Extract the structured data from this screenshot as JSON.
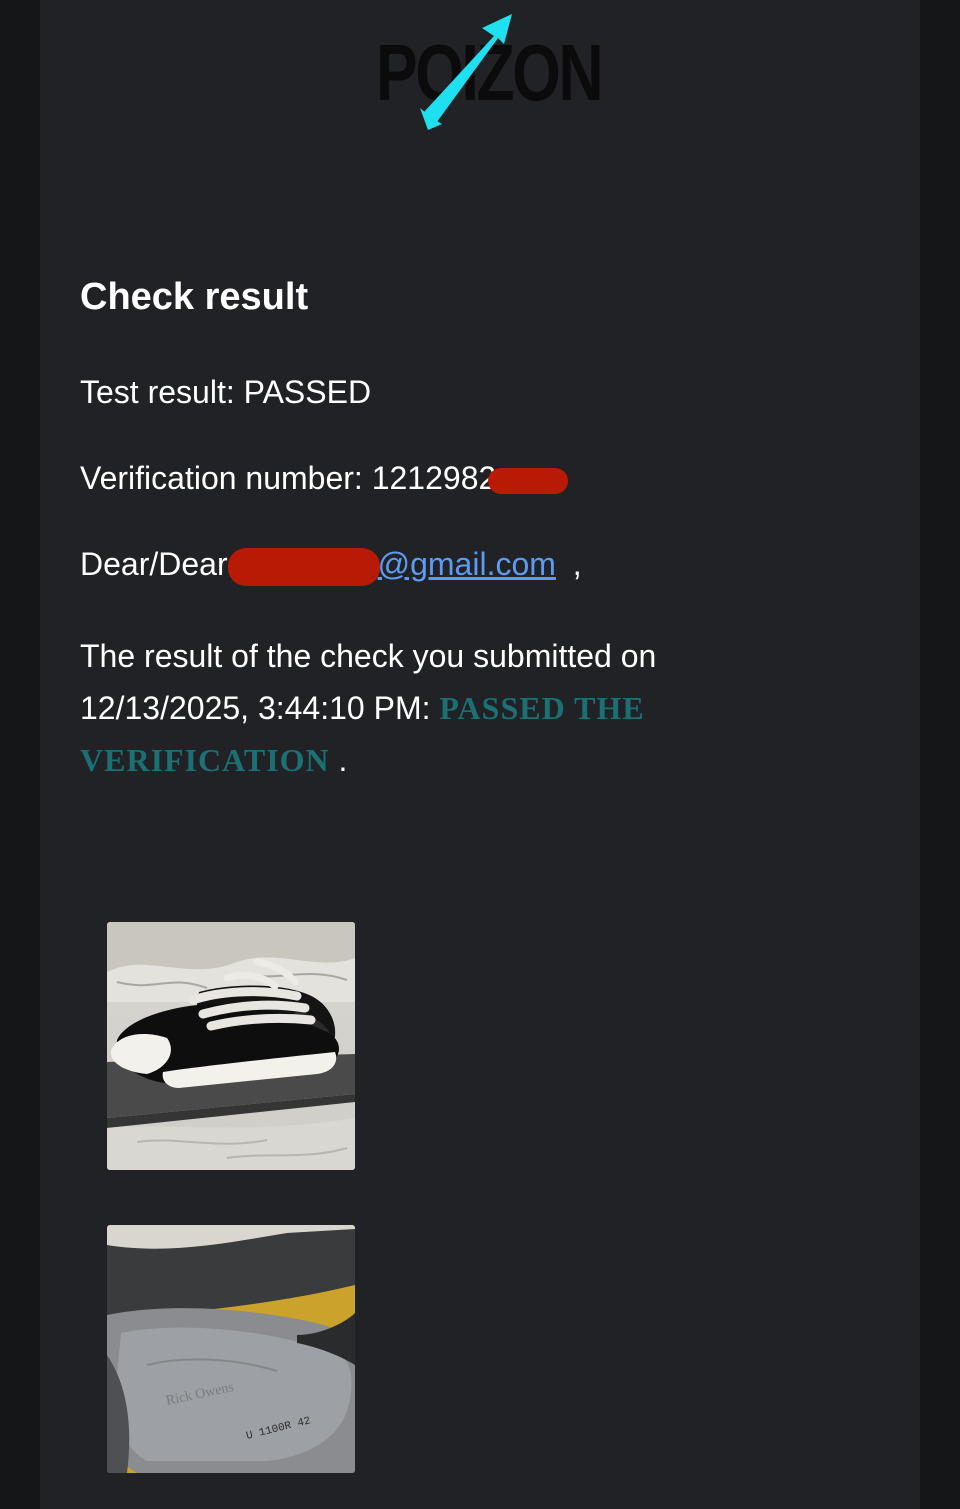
{
  "brand": {
    "logo_text": "POIZON",
    "logo_color": "#0b0b0b",
    "accent_color": "#1ee0f0"
  },
  "content": {
    "title": "Check result",
    "test_result": "Test result: PASSED",
    "verification_label": "Verification number: 1212982",
    "greeting_prefix": "Dear/Dear",
    "email_suffix": "@gmail.com",
    "greeting_comma": ",",
    "message_part1": "The result of the check you submitted on 12/13/2025, 3:44:10 PM:",
    "status_text": "PASSED THE VERIFICATION",
    "status_color": "#1b7074",
    "trailing_period": "."
  },
  "photos": [
    {
      "name": "sneaker-photo",
      "depicts": "black and white sneakers on a shoe box on a bed"
    },
    {
      "name": "insole-photo",
      "depicts": "close-up of the sneaker insole"
    }
  ],
  "colors": {
    "page_bg": "#151618",
    "card_bg": "#212226",
    "link": "#5e9bf0",
    "redaction": "#b81a06"
  }
}
